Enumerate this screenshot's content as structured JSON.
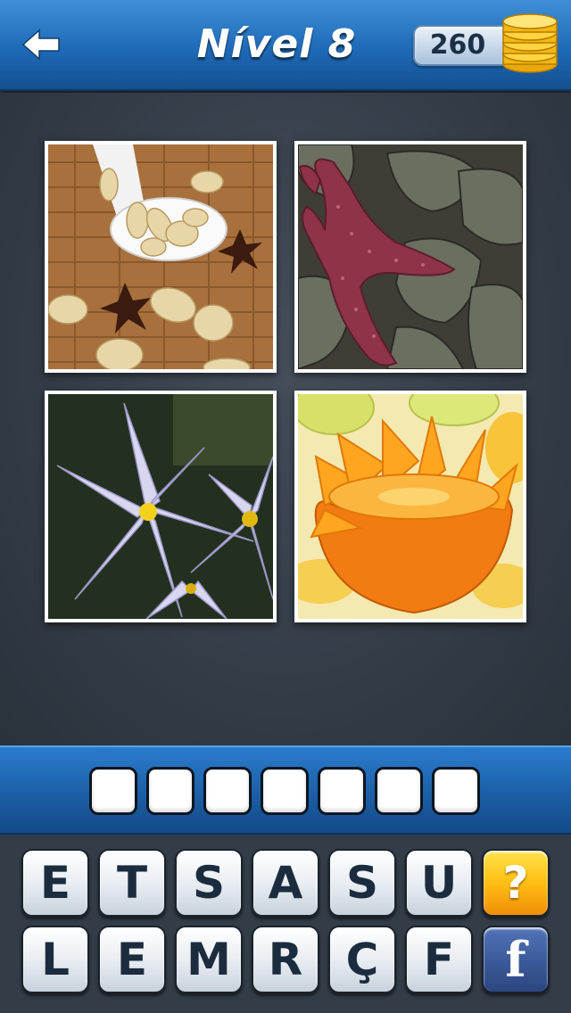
{
  "header": {
    "title": "Nível 8",
    "coins": "260",
    "back_icon": "arrow-left-icon",
    "coin_icon": "coin-stack-icon"
  },
  "puzzle": {
    "images": [
      {
        "name": "almonds-star-anise-photo"
      },
      {
        "name": "starfish-on-rocks-photo"
      },
      {
        "name": "white-flowers-photo"
      },
      {
        "name": "orange-fruit-photo"
      }
    ],
    "answer_slots": [
      "",
      "",
      "",
      "",
      "",
      "",
      ""
    ]
  },
  "keyboard": {
    "row1": [
      "E",
      "T",
      "S",
      "A",
      "S",
      "U"
    ],
    "row2": [
      "L",
      "E",
      "M",
      "R",
      "Ç",
      "F"
    ],
    "hint_label": "?",
    "facebook_label": "f"
  },
  "colors": {
    "header_blue": "#1f6ab8",
    "hint_gold": "#ffbf14",
    "facebook_blue": "#3b5998",
    "background": "#2c3540"
  }
}
